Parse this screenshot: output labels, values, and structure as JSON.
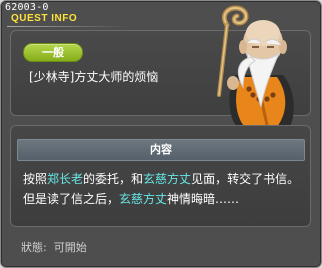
{
  "quest": {
    "id": "62003-0",
    "header_title": "QUEST INFO",
    "category": "一般",
    "name": "[少林寺]方丈大师的烦恼",
    "npc_icon": "elderly-monk-with-staff-icon"
  },
  "content": {
    "header": "内容",
    "description": {
      "p1": "按照",
      "n1": "郑长老",
      "p2": "的委托，和",
      "n2": "玄慈方丈",
      "p3": "见面，转交了书信。但是读了信之后，",
      "n3": "玄慈方丈",
      "p4": "神情晦暗……"
    },
    "highlight_color": "#66e6e6"
  },
  "status": {
    "label": "狀態:",
    "value": "可開始"
  }
}
